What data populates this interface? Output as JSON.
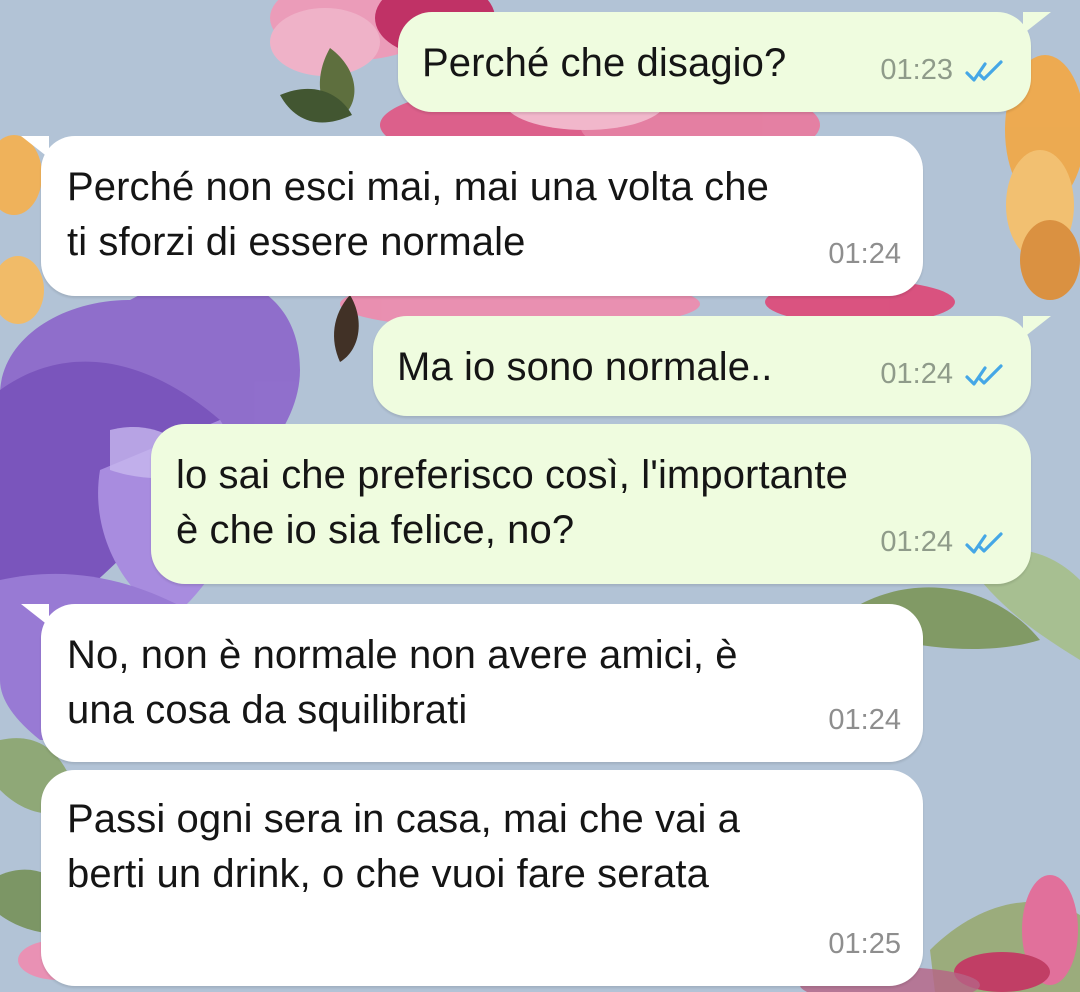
{
  "theme": {
    "outgoing_color": "#effcdf",
    "incoming_color": "#ffffff",
    "read_tick_color": "#45a7e6",
    "wallpaper_main": "#aebfd3"
  },
  "messages": [
    {
      "id": "m1",
      "direction": "outgoing",
      "text": "Perché che disagio?",
      "time": "01:23",
      "status_icon": "double-check-icon"
    },
    {
      "id": "m2",
      "direction": "incoming",
      "text": "Perché non esci mai, mai una volta che\nti sforzi di essere normale",
      "time": "01:24"
    },
    {
      "id": "m3",
      "direction": "outgoing",
      "text": "Ma io sono normale..",
      "time": "01:24",
      "status_icon": "double-check-icon"
    },
    {
      "id": "m4",
      "direction": "outgoing",
      "text": "lo sai che preferisco così, l'importante\nè che io sia felice, no?",
      "time": "01:24",
      "status_icon": "double-check-icon"
    },
    {
      "id": "m5",
      "direction": "incoming",
      "text": "No, non è normale non avere amici, è\nuna cosa da squilibrati",
      "time": "01:24"
    },
    {
      "id": "m6",
      "direction": "incoming",
      "text": "Passi ogni sera in casa, mai che vai a\nberti un drink, o che vuoi fare serata",
      "time": "01:25"
    }
  ]
}
